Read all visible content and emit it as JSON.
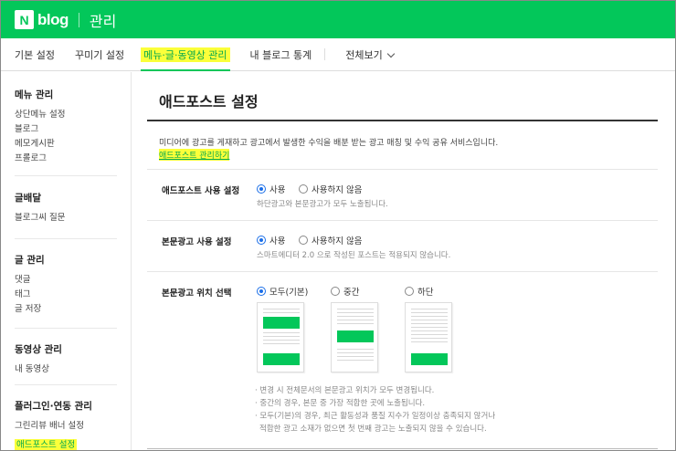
{
  "header": {
    "logo_mark": "N",
    "logo_text": "blog",
    "section_title": "관리"
  },
  "tabs": [
    {
      "label": "기본 설정"
    },
    {
      "label": "꾸미기 설정"
    },
    {
      "label": "메뉴·글·동영상 관리"
    },
    {
      "label": "내 블로그 통계"
    },
    {
      "label": "전체보기"
    }
  ],
  "sidebar": {
    "groups": [
      {
        "title": "메뉴 관리",
        "items": [
          "상단메뉴 설정",
          "블로그",
          "메모게시판",
          "프롤로그"
        ]
      },
      {
        "title": "글배달",
        "items": [
          "블로그씨 질문"
        ]
      },
      {
        "title": "글 관리",
        "items": [
          "댓글",
          "태그",
          "글 저장"
        ]
      },
      {
        "title": "동영상 관리",
        "items": [
          "내 동영상"
        ]
      },
      {
        "title": "플러그인·연동 관리",
        "items": [
          "그린리뷰 배너 설정",
          "애드포스트 설정"
        ]
      }
    ]
  },
  "main": {
    "title": "애드포스트 설정",
    "description": "미디어에 광고를 게재하고 광고에서 발생한 수익을 배분 받는 광고 매칭 및 수익 공유 서비스입니다.",
    "link": "애드포스트 관리하기",
    "rows": [
      {
        "label": "애드포스트 사용 설정",
        "option_on": "사용",
        "option_off": "사용하지 않음",
        "hint": "하단광고와 본문광고가 모두 노출됩니다."
      },
      {
        "label": "본문광고 사용 설정",
        "option_on": "사용",
        "option_off": "사용하지 않음",
        "hint": "스마트에디터 2.0 으로 작성된 포스트는 적용되지 않습니다."
      },
      {
        "label": "본문광고 위치 선택",
        "options": [
          "모두(기본)",
          "중간",
          "하단"
        ],
        "selected": "모두(기본)"
      }
    ],
    "notes": [
      "· 변경 시 전체문서의 본문광고 위치가 모두 변경됩니다.",
      "· 중간의 경우, 본문 중 가장 적합한 곳에 노출됩니다.",
      "· 모두(기본)의 경우, 최근 활동성과 품질 지수가 일정이상 충족되지 않거나",
      "  적합한 광고 소재가 없으면 첫 번째 광고는 노출되지 않을 수 있습니다."
    ]
  },
  "colors": {
    "brand_green": "#03c75a",
    "highlight": "#fbff3a",
    "radio_blue": "#1a6ee8"
  }
}
